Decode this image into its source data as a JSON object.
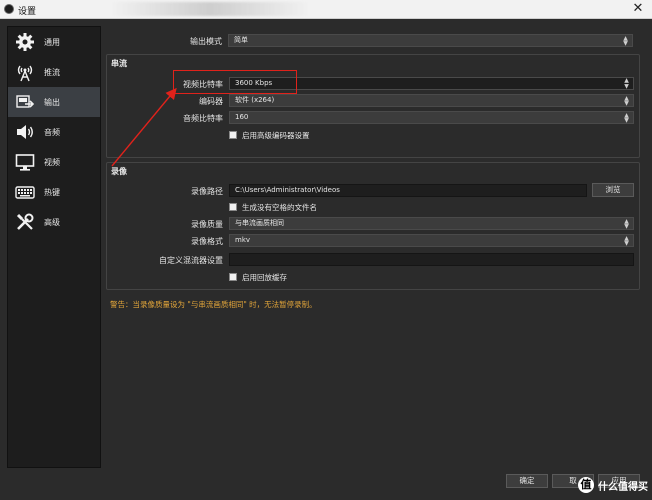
{
  "window": {
    "title": "设置",
    "close_glyph": "✕"
  },
  "sidebar": {
    "items": [
      {
        "label": "通用",
        "icon": "gear-icon",
        "active": false
      },
      {
        "label": "推流",
        "icon": "broadcast-icon",
        "active": false
      },
      {
        "label": "输出",
        "icon": "output-icon",
        "active": true
      },
      {
        "label": "音频",
        "icon": "speaker-icon",
        "active": false
      },
      {
        "label": "视频",
        "icon": "monitor-icon",
        "active": false
      },
      {
        "label": "热键",
        "icon": "keyboard-icon",
        "active": false
      },
      {
        "label": "高级",
        "icon": "wrench-icon",
        "active": false
      }
    ]
  },
  "output_mode": {
    "label": "输出模式",
    "value": "简单"
  },
  "streaming": {
    "title": "串流",
    "video_bitrate": {
      "label": "视频比特率",
      "value": "3600 Kbps"
    },
    "encoder": {
      "label": "编码器",
      "value": "软件 (x264)"
    },
    "audio_bitrate": {
      "label": "音频比特率",
      "value": "160"
    },
    "advanced_encoder": {
      "label": "启用高级编码器设置",
      "checked": false
    }
  },
  "recording": {
    "title": "录像",
    "path": {
      "label": "录像路径",
      "value": "C:\\Users\\Administrator\\Videos",
      "browse": "浏览"
    },
    "no_space": {
      "label": "生成没有空格的文件名",
      "checked": false
    },
    "quality": {
      "label": "录像质量",
      "value": "与串流画质相同"
    },
    "format": {
      "label": "录像格式",
      "value": "mkv"
    },
    "muxer": {
      "label": "自定义混流器设置",
      "value": ""
    },
    "replay_buffer": {
      "label": "启用回放缓存",
      "checked": false
    }
  },
  "warning": "警告：当录像质量设为 \"与串流画质相同\" 时，无法暂停录制。",
  "buttons": {
    "ok": "确定",
    "cancel": "取",
    "apply": "应用"
  },
  "watermark": {
    "glyph": "值",
    "text": "什么值得买"
  },
  "colors": {
    "accent_warning": "#e2a53a",
    "annotation_red": "#e0221b",
    "panel_bg": "#2b2b2b",
    "sidebar_bg": "#1d1d1d"
  }
}
